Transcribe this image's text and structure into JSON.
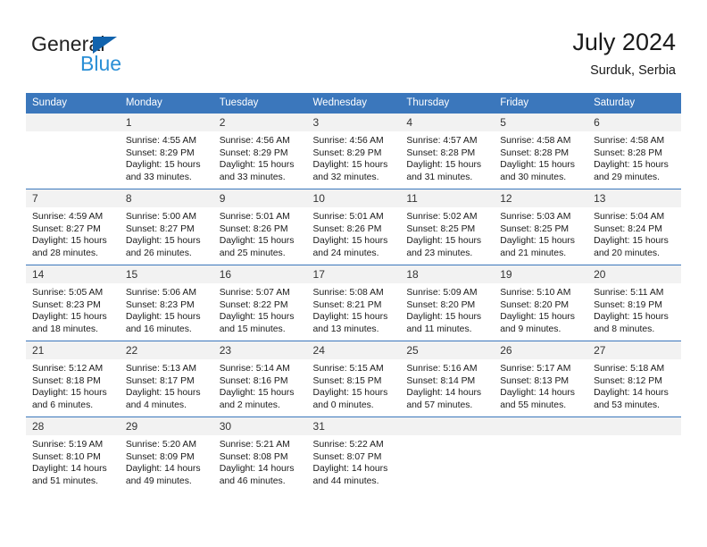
{
  "brand": {
    "name_dark": "General",
    "name_blue": "Blue",
    "triangle_color": "#1163ad",
    "blue_color": "#2a8fd6"
  },
  "header": {
    "title": "July 2024",
    "subtitle": "Surduk, Serbia"
  },
  "theme": {
    "header_row_bg": "#3b77bc",
    "header_row_text": "#ffffff",
    "daynum_bg": "#f2f2f2",
    "cell_bg": "#ffffff",
    "grid_line": "#3b77bc",
    "body_text": "#1a1a1a"
  },
  "calendar": {
    "weekday_headers": [
      "Sunday",
      "Monday",
      "Tuesday",
      "Wednesday",
      "Thursday",
      "Friday",
      "Saturday"
    ],
    "weeks": [
      [
        {
          "day": "",
          "sunrise": "",
          "sunset": "",
          "daylight1": "",
          "daylight2": ""
        },
        {
          "day": "1",
          "sunrise": "Sunrise: 4:55 AM",
          "sunset": "Sunset: 8:29 PM",
          "daylight1": "Daylight: 15 hours",
          "daylight2": "and 33 minutes."
        },
        {
          "day": "2",
          "sunrise": "Sunrise: 4:56 AM",
          "sunset": "Sunset: 8:29 PM",
          "daylight1": "Daylight: 15 hours",
          "daylight2": "and 33 minutes."
        },
        {
          "day": "3",
          "sunrise": "Sunrise: 4:56 AM",
          "sunset": "Sunset: 8:29 PM",
          "daylight1": "Daylight: 15 hours",
          "daylight2": "and 32 minutes."
        },
        {
          "day": "4",
          "sunrise": "Sunrise: 4:57 AM",
          "sunset": "Sunset: 8:28 PM",
          "daylight1": "Daylight: 15 hours",
          "daylight2": "and 31 minutes."
        },
        {
          "day": "5",
          "sunrise": "Sunrise: 4:58 AM",
          "sunset": "Sunset: 8:28 PM",
          "daylight1": "Daylight: 15 hours",
          "daylight2": "and 30 minutes."
        },
        {
          "day": "6",
          "sunrise": "Sunrise: 4:58 AM",
          "sunset": "Sunset: 8:28 PM",
          "daylight1": "Daylight: 15 hours",
          "daylight2": "and 29 minutes."
        }
      ],
      [
        {
          "day": "7",
          "sunrise": "Sunrise: 4:59 AM",
          "sunset": "Sunset: 8:27 PM",
          "daylight1": "Daylight: 15 hours",
          "daylight2": "and 28 minutes."
        },
        {
          "day": "8",
          "sunrise": "Sunrise: 5:00 AM",
          "sunset": "Sunset: 8:27 PM",
          "daylight1": "Daylight: 15 hours",
          "daylight2": "and 26 minutes."
        },
        {
          "day": "9",
          "sunrise": "Sunrise: 5:01 AM",
          "sunset": "Sunset: 8:26 PM",
          "daylight1": "Daylight: 15 hours",
          "daylight2": "and 25 minutes."
        },
        {
          "day": "10",
          "sunrise": "Sunrise: 5:01 AM",
          "sunset": "Sunset: 8:26 PM",
          "daylight1": "Daylight: 15 hours",
          "daylight2": "and 24 minutes."
        },
        {
          "day": "11",
          "sunrise": "Sunrise: 5:02 AM",
          "sunset": "Sunset: 8:25 PM",
          "daylight1": "Daylight: 15 hours",
          "daylight2": "and 23 minutes."
        },
        {
          "day": "12",
          "sunrise": "Sunrise: 5:03 AM",
          "sunset": "Sunset: 8:25 PM",
          "daylight1": "Daylight: 15 hours",
          "daylight2": "and 21 minutes."
        },
        {
          "day": "13",
          "sunrise": "Sunrise: 5:04 AM",
          "sunset": "Sunset: 8:24 PM",
          "daylight1": "Daylight: 15 hours",
          "daylight2": "and 20 minutes."
        }
      ],
      [
        {
          "day": "14",
          "sunrise": "Sunrise: 5:05 AM",
          "sunset": "Sunset: 8:23 PM",
          "daylight1": "Daylight: 15 hours",
          "daylight2": "and 18 minutes."
        },
        {
          "day": "15",
          "sunrise": "Sunrise: 5:06 AM",
          "sunset": "Sunset: 8:23 PM",
          "daylight1": "Daylight: 15 hours",
          "daylight2": "and 16 minutes."
        },
        {
          "day": "16",
          "sunrise": "Sunrise: 5:07 AM",
          "sunset": "Sunset: 8:22 PM",
          "daylight1": "Daylight: 15 hours",
          "daylight2": "and 15 minutes."
        },
        {
          "day": "17",
          "sunrise": "Sunrise: 5:08 AM",
          "sunset": "Sunset: 8:21 PM",
          "daylight1": "Daylight: 15 hours",
          "daylight2": "and 13 minutes."
        },
        {
          "day": "18",
          "sunrise": "Sunrise: 5:09 AM",
          "sunset": "Sunset: 8:20 PM",
          "daylight1": "Daylight: 15 hours",
          "daylight2": "and 11 minutes."
        },
        {
          "day": "19",
          "sunrise": "Sunrise: 5:10 AM",
          "sunset": "Sunset: 8:20 PM",
          "daylight1": "Daylight: 15 hours",
          "daylight2": "and 9 minutes."
        },
        {
          "day": "20",
          "sunrise": "Sunrise: 5:11 AM",
          "sunset": "Sunset: 8:19 PM",
          "daylight1": "Daylight: 15 hours",
          "daylight2": "and 8 minutes."
        }
      ],
      [
        {
          "day": "21",
          "sunrise": "Sunrise: 5:12 AM",
          "sunset": "Sunset: 8:18 PM",
          "daylight1": "Daylight: 15 hours",
          "daylight2": "and 6 minutes."
        },
        {
          "day": "22",
          "sunrise": "Sunrise: 5:13 AM",
          "sunset": "Sunset: 8:17 PM",
          "daylight1": "Daylight: 15 hours",
          "daylight2": "and 4 minutes."
        },
        {
          "day": "23",
          "sunrise": "Sunrise: 5:14 AM",
          "sunset": "Sunset: 8:16 PM",
          "daylight1": "Daylight: 15 hours",
          "daylight2": "and 2 minutes."
        },
        {
          "day": "24",
          "sunrise": "Sunrise: 5:15 AM",
          "sunset": "Sunset: 8:15 PM",
          "daylight1": "Daylight: 15 hours",
          "daylight2": "and 0 minutes."
        },
        {
          "day": "25",
          "sunrise": "Sunrise: 5:16 AM",
          "sunset": "Sunset: 8:14 PM",
          "daylight1": "Daylight: 14 hours",
          "daylight2": "and 57 minutes."
        },
        {
          "day": "26",
          "sunrise": "Sunrise: 5:17 AM",
          "sunset": "Sunset: 8:13 PM",
          "daylight1": "Daylight: 14 hours",
          "daylight2": "and 55 minutes."
        },
        {
          "day": "27",
          "sunrise": "Sunrise: 5:18 AM",
          "sunset": "Sunset: 8:12 PM",
          "daylight1": "Daylight: 14 hours",
          "daylight2": "and 53 minutes."
        }
      ],
      [
        {
          "day": "28",
          "sunrise": "Sunrise: 5:19 AM",
          "sunset": "Sunset: 8:10 PM",
          "daylight1": "Daylight: 14 hours",
          "daylight2": "and 51 minutes."
        },
        {
          "day": "29",
          "sunrise": "Sunrise: 5:20 AM",
          "sunset": "Sunset: 8:09 PM",
          "daylight1": "Daylight: 14 hours",
          "daylight2": "and 49 minutes."
        },
        {
          "day": "30",
          "sunrise": "Sunrise: 5:21 AM",
          "sunset": "Sunset: 8:08 PM",
          "daylight1": "Daylight: 14 hours",
          "daylight2": "and 46 minutes."
        },
        {
          "day": "31",
          "sunrise": "Sunrise: 5:22 AM",
          "sunset": "Sunset: 8:07 PM",
          "daylight1": "Daylight: 14 hours",
          "daylight2": "and 44 minutes."
        },
        {
          "day": "",
          "sunrise": "",
          "sunset": "",
          "daylight1": "",
          "daylight2": ""
        },
        {
          "day": "",
          "sunrise": "",
          "sunset": "",
          "daylight1": "",
          "daylight2": ""
        },
        {
          "day": "",
          "sunrise": "",
          "sunset": "",
          "daylight1": "",
          "daylight2": ""
        }
      ]
    ]
  }
}
